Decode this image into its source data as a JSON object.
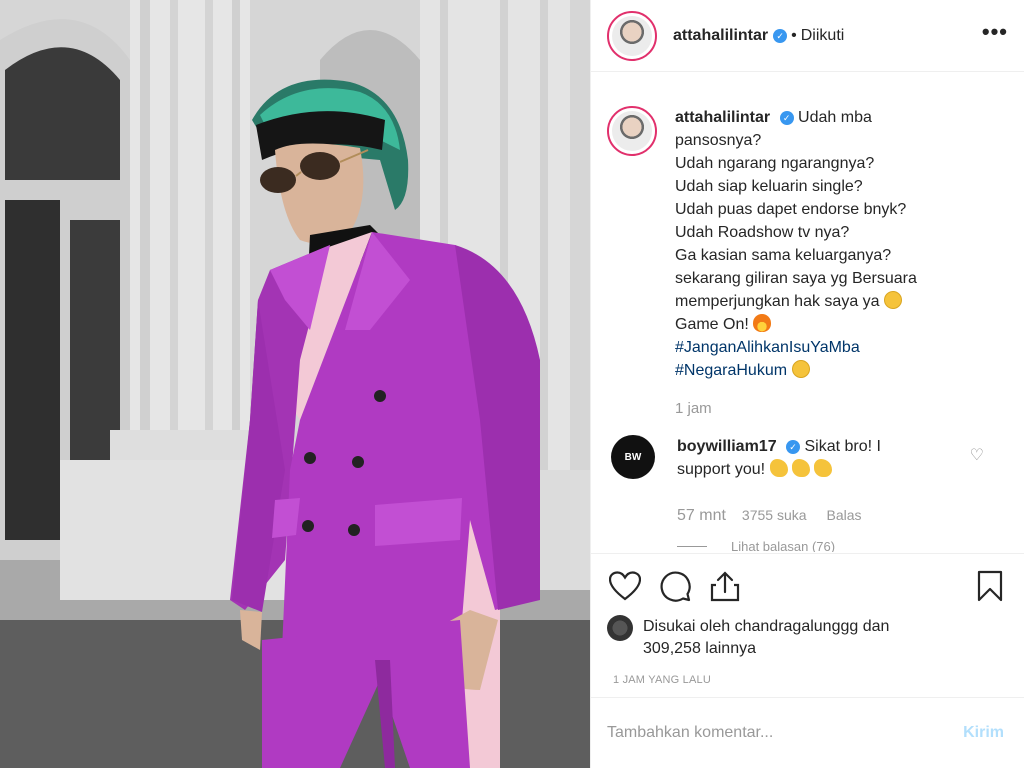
{
  "post": {
    "username": "attahalilintar",
    "follow_status": "Diikuti",
    "more_label": "•••"
  },
  "caption": {
    "username": "attahalilintar",
    "lines": [
      "Udah mba",
      "pansosnya?",
      "Udah ngarang ngarangnya?",
      "Udah siap keluarin single?",
      "Udah puas dapet endorse bnyk?",
      "Udah Roadshow tv nya?",
      "Ga kasian sama keluarganya?",
      "sekarang giliran saya yg Bersuara",
      "memperjungkan hak saya ya",
      "Game On!"
    ],
    "hashtag_1": "#JanganAlihkanIsuYaMba",
    "hashtag_2": "#NegaraHukum",
    "time": "1 jam"
  },
  "reply": {
    "username": "boywilliam17",
    "text_1": "Sikat bro! I",
    "text_2": "support you!",
    "avatar_text": "BW",
    "time": "57 mnt",
    "likes": "3755 suka",
    "reply_label": "Balas",
    "view_replies": "Lihat balasan (76)"
  },
  "likes": {
    "prefix": "Disukai oleh",
    "user": "chandragalunggg",
    "middle": "dan",
    "count": "309,258 lainnya"
  },
  "timestamp": "1 JAM YANG LALU",
  "add_comment": {
    "placeholder": "Tambahkan komentar...",
    "post_label": "Kirim"
  },
  "colors": {
    "link_blue": "#003569",
    "verified_blue": "#3897f0",
    "post_button_disabled": "#b2dffc",
    "suit_magenta": "#b03ac2"
  },
  "icons": [
    "heart-icon",
    "comment-icon",
    "share-icon",
    "bookmark-icon",
    "verified-icon",
    "more-options-icon"
  ]
}
